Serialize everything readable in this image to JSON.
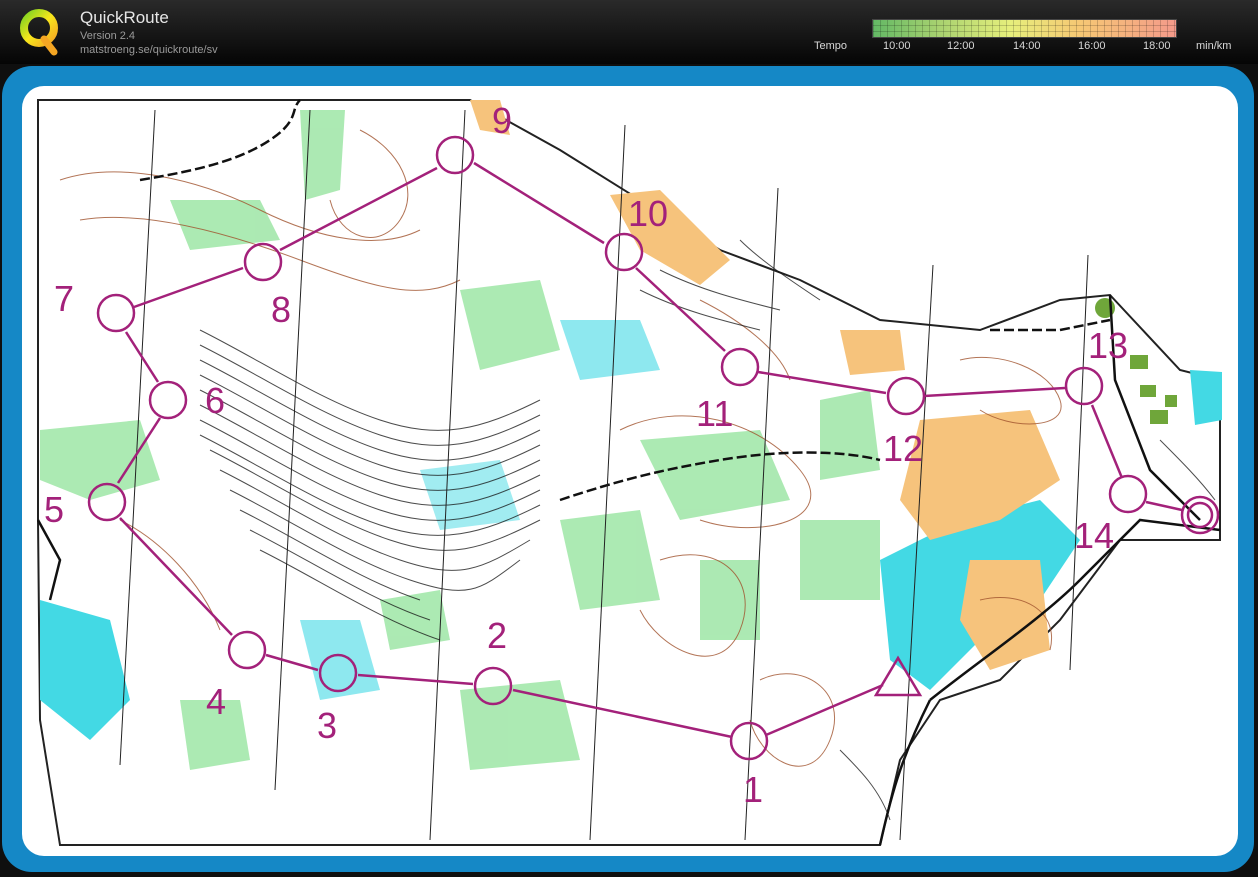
{
  "app": {
    "title": "QuickRoute",
    "version": "Version 2.4",
    "url": "matstroeng.se/quickroute/sv"
  },
  "tempo": {
    "label": "Tempo",
    "ticks": [
      "10:00",
      "12:00",
      "14:00",
      "16:00",
      "18:00"
    ],
    "unit": "min/km"
  },
  "colors": {
    "course": "#a3217a",
    "frame": "#1588c6",
    "forest_green": "#7fdc7f",
    "water": "#3fd6e3",
    "open_land": "#f3c27a",
    "contour": "#8b4513"
  },
  "controls": [
    "1",
    "2",
    "3",
    "4",
    "5",
    "6",
    "7",
    "8",
    "9",
    "10",
    "11",
    "12",
    "13",
    "14"
  ]
}
